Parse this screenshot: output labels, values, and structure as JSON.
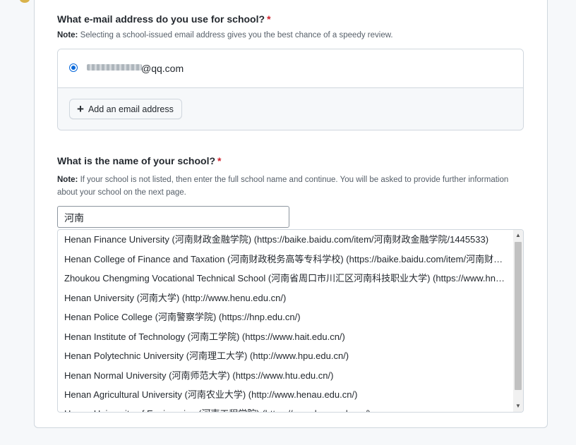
{
  "email_section": {
    "title": "What e-mail address do you use for school?",
    "required_mark": "*",
    "note_label": "Note:",
    "note_text": " Selecting a school-issued email address gives you the best chance of a speedy review.",
    "selected_email": "@qq.com",
    "add_button_label": "Add an email address",
    "add_icon": "plus-icon"
  },
  "school_section": {
    "title": "What is the name of your school?",
    "required_mark": "*",
    "note_label": "Note:",
    "note_text": " If your school is not listed, then enter the full school name and continue. You will be asked to provide further information about your school on the next page.",
    "input_value": "河南",
    "options": [
      "Henan Finance University (河南财政金融学院) (https://baike.baidu.com/item/河南财政金融学院/1445533)",
      "Henan College of Finance and Taxation (河南财政税务高等专科学校) (https://baike.baidu.com/item/河南财政税务高等专科学校)",
      "Zhoukou Chengming Vocational Technical School (河南省周口市川汇区河南科技职业大学) (https://www.hnkjzy.edu.cn/)",
      "Henan University (河南大学) (http://www.henu.edu.cn/)",
      "Henan Police College (河南警察学院) (https://hnp.edu.cn/)",
      "Henan Institute of Technology (河南工学院) (https://www.hait.edu.cn/)",
      "Henan Polytechnic University (河南理工大学) (http://www.hpu.edu.cn/)",
      "Henan Normal University (河南师范大学) (https://www.htu.edu.cn/)",
      "Henan Agricultural University (河南农业大学) (http://www.henau.edu.cn/)",
      "Henan University of Engineering (河南工程学院) (https://www.haue.edu.cn/)"
    ]
  },
  "colors": {
    "accent": "#0969da",
    "required": "#cf222e",
    "border": "#d0d7de",
    "page_bg": "#f6f8fa"
  }
}
